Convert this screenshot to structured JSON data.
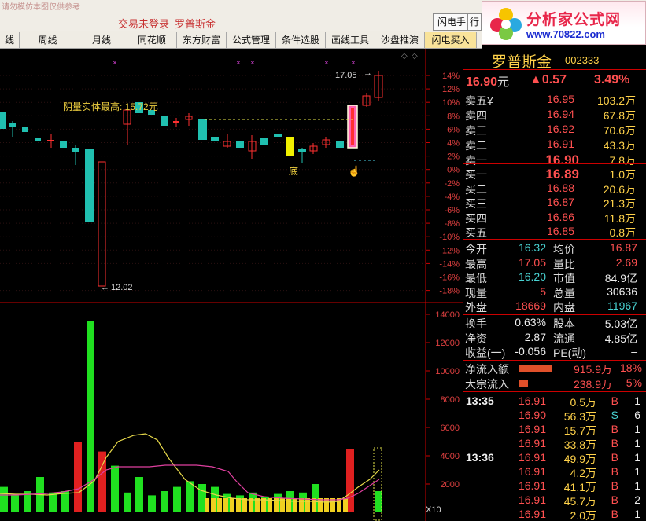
{
  "titlebar": {
    "blurred_text": "请勿模仿本图仅供参考",
    "login_status": "交易未登录",
    "stock_name": "罗普斯金",
    "buttons": [
      "闪电手",
      "行"
    ]
  },
  "logo": {
    "brand": "分析家公式网",
    "url": "www.70822.com"
  },
  "toolbar": {
    "tabs": [
      "线",
      "周线",
      "月线",
      "同花顺",
      "东方财富",
      "公式管理",
      "条件选股",
      "画线工具",
      "沙盘推演",
      "闪电买入"
    ],
    "active_tab": "闪电买入"
  },
  "chart": {
    "price_axis_labels": [
      "14%",
      "12%",
      "10%",
      "8%",
      "6%",
      "4%",
      "2%",
      "0%",
      "-2%",
      "-4%",
      "-6%",
      "-8%",
      "-10%",
      "-12%",
      "-14%",
      "-16%",
      "-18%"
    ],
    "volume_axis_labels": [
      "14000",
      "12000",
      "10000",
      "8000",
      "6000",
      "4000",
      "2000"
    ],
    "annotation_high": "17.05",
    "annotation_low": "12.02",
    "annotation_text": "阴量实体最高: 15.72元",
    "bottom_marker": "底",
    "scale_label": "X10",
    "colors": {
      "up": "#ff3030",
      "down": "#20c0b0",
      "vol_up": "#e02020",
      "vol_down": "#20e020",
      "ma_yellow": "#e6d84a",
      "ma_magenta": "#e040a0"
    }
  },
  "chart_data": {
    "type": "bar",
    "title": "",
    "price_range_pct": [
      -18,
      14
    ],
    "volume_range": [
      0,
      14000
    ],
    "volume_series": [
      {
        "name": "",
        "values": [
          1800,
          1200,
          1500,
          2500,
          1400,
          1500,
          5000,
          13500,
          4300,
          3300,
          1400,
          2500,
          1200,
          1500,
          1800,
          2200,
          2000,
          1800,
          1300,
          1200,
          1400,
          1100,
          1300,
          1500,
          1400,
          2000,
          4500,
          1500
        ]
      }
    ]
  },
  "quote": {
    "name": "罗普斯金",
    "code": "002333",
    "price": "16.90",
    "price_unit": "元",
    "change": "▲0.57",
    "change_pct": "3.49%",
    "asks": [
      {
        "label": "卖五",
        "flag": "¥",
        "price": "16.95",
        "vol": "103.2万"
      },
      {
        "label": "卖四",
        "flag": "",
        "price": "16.94",
        "vol": "67.8万"
      },
      {
        "label": "卖三",
        "flag": "",
        "price": "16.92",
        "vol": "70.6万"
      },
      {
        "label": "卖二",
        "flag": "",
        "price": "16.91",
        "vol": "43.3万"
      },
      {
        "label": "卖一",
        "flag": "",
        "price": "16.90",
        "vol": "7.8万"
      }
    ],
    "bids": [
      {
        "label": "买一",
        "price": "16.89",
        "vol": "1.0万"
      },
      {
        "label": "买二",
        "price": "16.88",
        "vol": "20.6万"
      },
      {
        "label": "买三",
        "price": "16.87",
        "vol": "21.3万"
      },
      {
        "label": "买四",
        "price": "16.86",
        "vol": "11.8万"
      },
      {
        "label": "买五",
        "price": "16.85",
        "vol": "0.8万"
      }
    ],
    "stats": [
      {
        "l1": "今开",
        "v1": "16.32",
        "c1": "dn",
        "l2": "均价",
        "v2": "16.87",
        "c2": "up"
      },
      {
        "l1": "最高",
        "v1": "17.05",
        "c1": "up",
        "l2": "量比",
        "v2": "2.69",
        "c2": "up"
      },
      {
        "l1": "最低",
        "v1": "16.20",
        "c1": "dn",
        "l2": "市值",
        "v2": "84.9亿",
        "c2": "wht"
      },
      {
        "l1": "现量",
        "v1": "5",
        "c1": "up",
        "l2": "总量",
        "v2": "30636",
        "c2": "wht"
      },
      {
        "l1": "外盘",
        "v1": "18669",
        "c1": "up",
        "l2": "内盘",
        "v2": "11967",
        "c2": "dn"
      }
    ],
    "fund": [
      {
        "l1": "换手",
        "v1": "0.63%",
        "l2": "股本",
        "v2": "5.03亿"
      },
      {
        "l1": "净资",
        "v1": "2.87",
        "l2": "流通",
        "v2": "4.85亿"
      },
      {
        "l1": "收益(一)",
        "v1": "-0.056",
        "l2": "PE(动)",
        "v2": "–"
      }
    ],
    "flows": [
      {
        "label": "净流入额",
        "value": "915.9万",
        "pct": "18%",
        "bar": 0.18
      },
      {
        "label": "大宗流入",
        "value": "238.9万",
        "pct": "5%",
        "bar": 0.05
      }
    ],
    "ticks": [
      {
        "time": "13:35",
        "price": "16.91",
        "vol": "0.5万",
        "side": "B",
        "n": "1"
      },
      {
        "time": "",
        "price": "16.90",
        "vol": "56.3万",
        "side": "S",
        "n": "6"
      },
      {
        "time": "",
        "price": "16.91",
        "vol": "15.7万",
        "side": "B",
        "n": "1"
      },
      {
        "time": "",
        "price": "16.91",
        "vol": "33.8万",
        "side": "B",
        "n": "1"
      },
      {
        "time": "13:36",
        "price": "16.91",
        "vol": "49.9万",
        "side": "B",
        "n": "1"
      },
      {
        "time": "",
        "price": "16.91",
        "vol": "4.2万",
        "side": "B",
        "n": "1"
      },
      {
        "time": "",
        "price": "16.91",
        "vol": "41.1万",
        "side": "B",
        "n": "1"
      },
      {
        "time": "",
        "price": "16.91",
        "vol": "45.7万",
        "side": "B",
        "n": "2"
      },
      {
        "time": "",
        "price": "16.91",
        "vol": "2.0万",
        "side": "B",
        "n": "1"
      }
    ]
  }
}
